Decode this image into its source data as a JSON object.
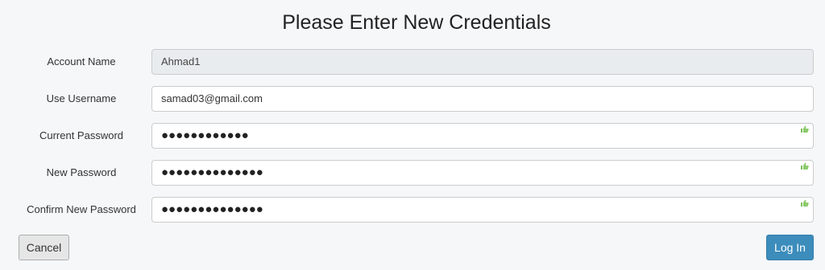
{
  "form": {
    "title": "Please Enter New Credentials",
    "fields": [
      {
        "label": "Account Name",
        "value": "Ahmad1"
      },
      {
        "label": "Use Username",
        "value": "samad03@gmail.com"
      },
      {
        "label": "Current Password",
        "value": "●●●●●●●●●●●●"
      },
      {
        "label": "New Password",
        "value": "●●●●●●●●●●●●●●"
      },
      {
        "label": "Confirm New Password",
        "value": "●●●●●●●●●●●●●●"
      }
    ],
    "cancel_label": "Cancel",
    "login_label": "Log In"
  },
  "icons": {
    "password_indicator": "thumbs-up-icon"
  },
  "colors": {
    "primary_button": "#3c8dbc",
    "indicator_green": "#7bbf5a"
  }
}
